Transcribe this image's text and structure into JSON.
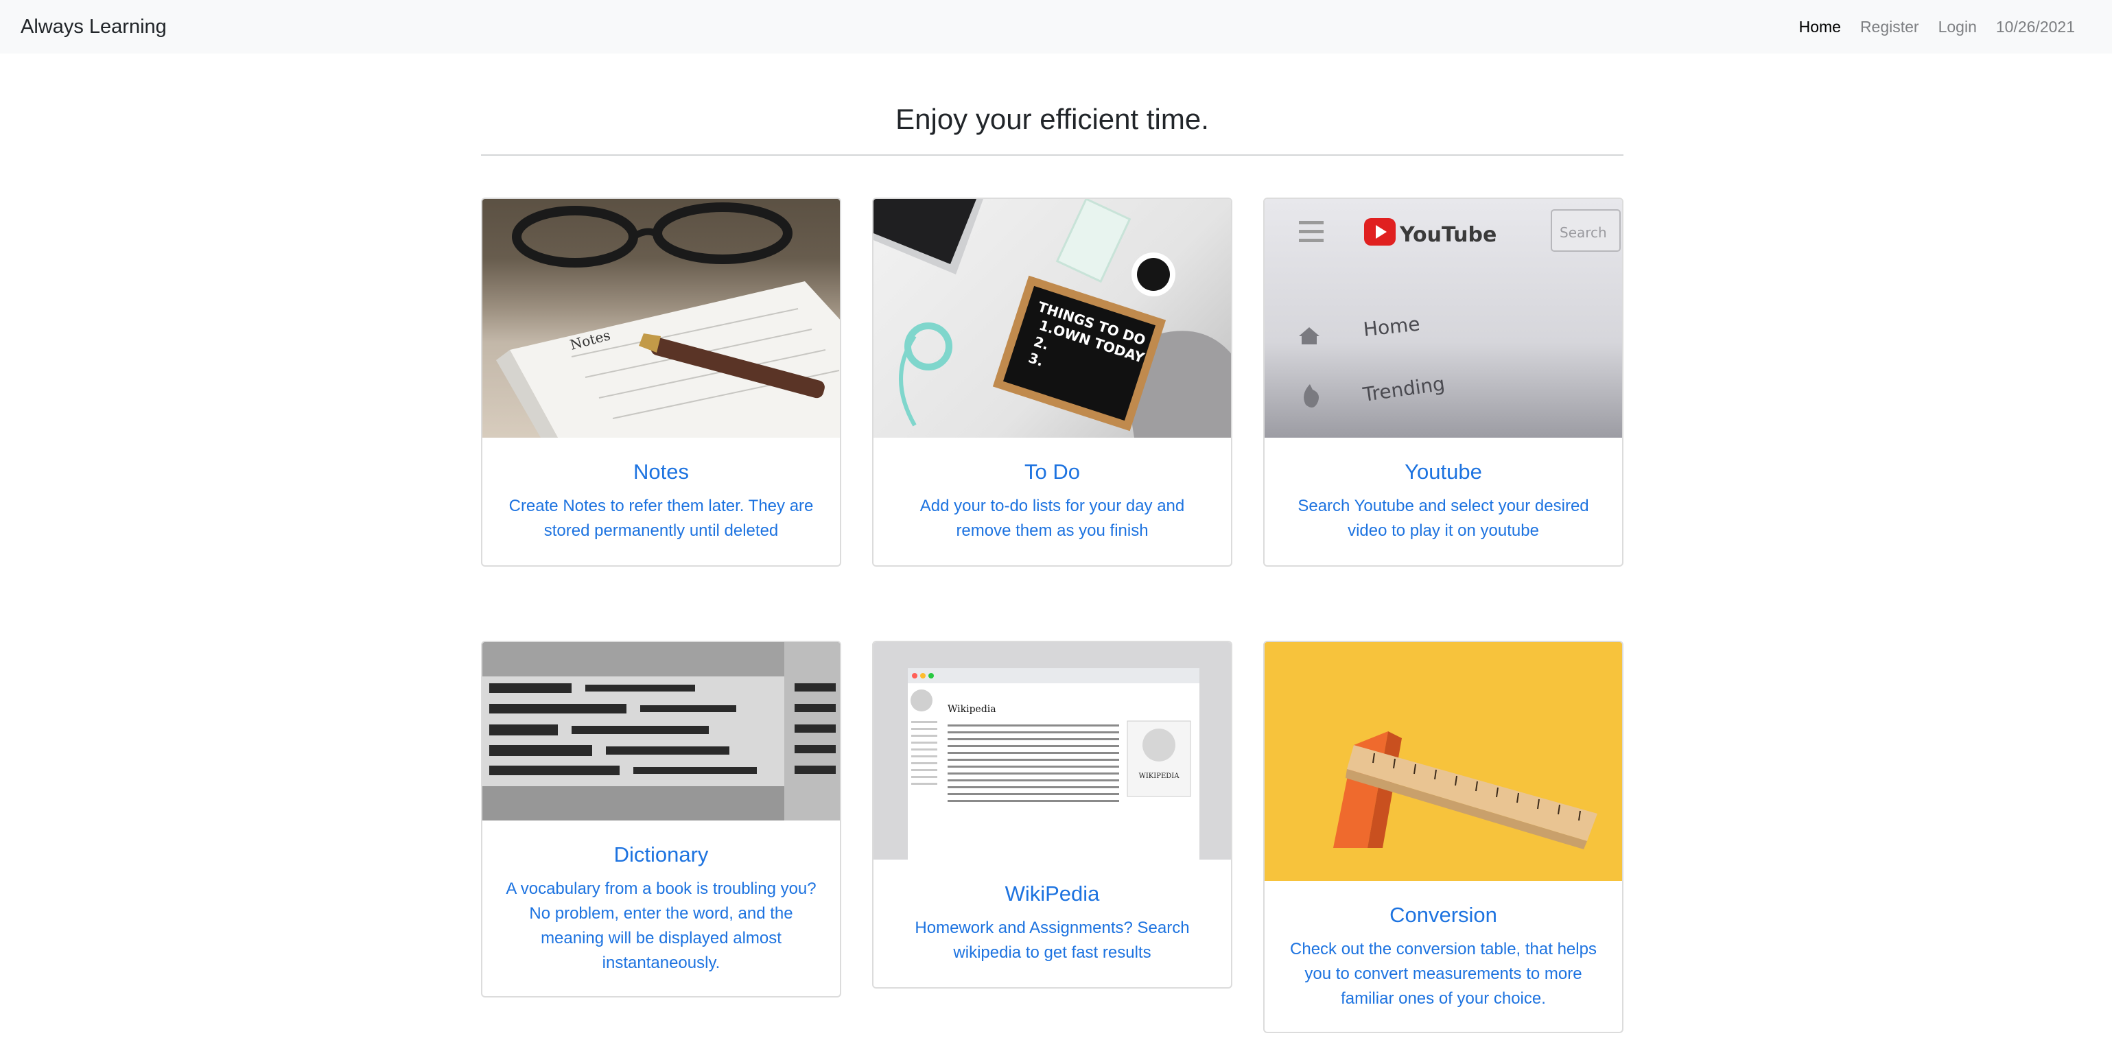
{
  "navbar": {
    "brand": "Always Learning",
    "links": [
      "Home",
      "Register",
      "Login"
    ],
    "date": "10/26/2021"
  },
  "main": {
    "heading": "Enjoy your efficient time."
  },
  "cards": [
    {
      "title": "Notes",
      "text": "Create Notes to refer them later. They are stored permanently until deleted",
      "image_label": "Notes"
    },
    {
      "title": "To Do",
      "text": "Add your to-do lists for your day and remove them as you finish",
      "image_lines": [
        "THINGS TO DO",
        "1.OWN TODAY",
        "2.",
        "3."
      ]
    },
    {
      "title": "Youtube",
      "text": "Search Youtube and select your desired video to play it on youtube",
      "image_words": [
        "YouTube",
        "Search",
        "Home",
        "Trending"
      ]
    },
    {
      "title": "Dictionary",
      "text": "A vocabulary from a book is troubling you? No problem, enter the word, and the meaning will be displayed almost instantaneously."
    },
    {
      "title": "WikiPedia",
      "text": "Homework and Assignments? Search wikipedia to get fast results",
      "image_words": [
        "Wikipedia",
        "WIKIPEDIA"
      ]
    },
    {
      "title": "Conversion",
      "text": "Check out the conversion table, that helps you to convert measurements to more familiar ones of your choice."
    }
  ],
  "colors": {
    "link": "#1d73e0",
    "navbar_bg": "#f8f9fa",
    "conversion_bg": "#f7c33c"
  }
}
